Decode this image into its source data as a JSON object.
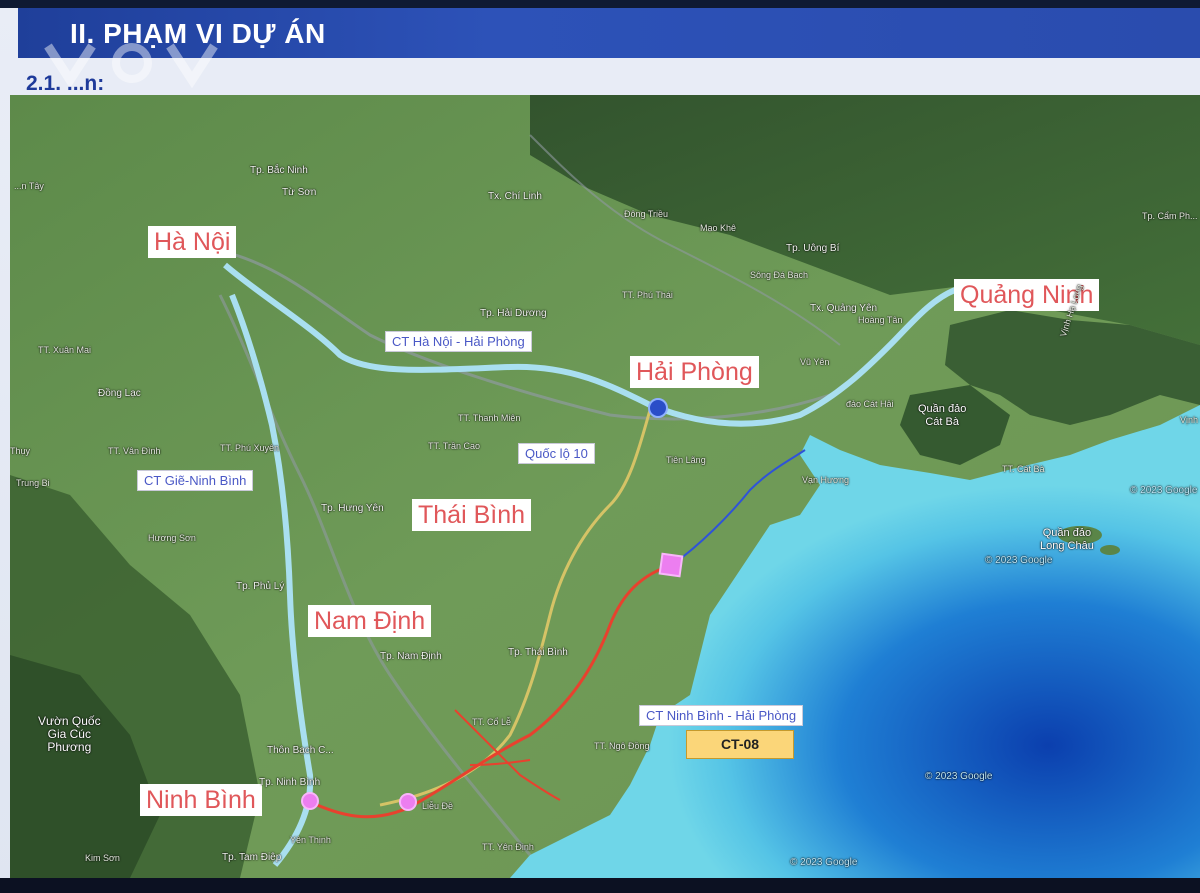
{
  "header": {
    "title": "II. PHẠM VI DỰ ÁN",
    "subheading": "2.1. ...n:"
  },
  "colors": {
    "title_bar": "#2a4cae",
    "city_label_text": "#e0575a",
    "route_label_text": "#4a58c6",
    "expressway_existing": "#a9dff0",
    "project_route": "#e8412e",
    "coastal_route": "#2f53d8",
    "badge_bg": "#fbd679"
  },
  "map": {
    "cities": [
      {
        "id": "ha-noi",
        "label": "Hà Nội"
      },
      {
        "id": "quang-ninh",
        "label": "Quảng Ninh"
      },
      {
        "id": "hai-phong",
        "label": "Hải Phòng"
      },
      {
        "id": "thai-binh",
        "label": "Thái Bình"
      },
      {
        "id": "nam-dinh",
        "label": "Nam Định"
      },
      {
        "id": "ninh-binh",
        "label": "Ninh Bình"
      }
    ],
    "routes": [
      {
        "id": "ct-hn-hp",
        "label": "CT Hà Nội - Hải Phòng"
      },
      {
        "id": "ql10",
        "label": "Quốc lộ 10"
      },
      {
        "id": "ct-gie-nb",
        "label": "CT Giẽ-Ninh Bình"
      },
      {
        "id": "ct-nb-hp",
        "label": "CT Ninh Bình - Hải Phòng"
      }
    ],
    "project_code": "CT-08",
    "places": [
      {
        "id": "bac-ninh",
        "label": "Tp. Bắc Ninh"
      },
      {
        "id": "tu-son",
        "label": "Từ Sơn"
      },
      {
        "id": "chi-linh",
        "label": "Tx. Chí Linh"
      },
      {
        "id": "hai-duong",
        "label": "Tp. Hải Dương"
      },
      {
        "id": "uong-bi",
        "label": "Tp. Uông Bí"
      },
      {
        "id": "song-da-bach",
        "label": "Sông Đá Bạch"
      },
      {
        "id": "quang-yen",
        "label": "Tx. Quảng Yên"
      },
      {
        "id": "hung-yen",
        "label": "Tp. Hưng Yên"
      },
      {
        "id": "phu-ly",
        "label": "Tp. Phủ Lý"
      },
      {
        "id": "tp-nam-dinh",
        "label": "Tp. Nam Định"
      },
      {
        "id": "tp-thai-binh",
        "label": "Tp. Thái Bình"
      },
      {
        "id": "tp-ninh-binh",
        "label": "Tp. Ninh Bình"
      },
      {
        "id": "tam-diep",
        "label": "Tp. Tam Điệp"
      },
      {
        "id": "yen-thinh",
        "label": "Yên Thịnh"
      },
      {
        "id": "kim-son",
        "label": "Kim Sơn"
      },
      {
        "id": "dong-lac",
        "label": "Đồng Lạc"
      },
      {
        "id": "tien-lang",
        "label": "Tiên Lãng"
      },
      {
        "id": "van-huong",
        "label": "Vạn Hương"
      },
      {
        "id": "thon-bach",
        "label": "Thôn Bạch C..."
      },
      {
        "id": "lieu-de",
        "label": "Liễu Đề"
      },
      {
        "id": "hoang-tan",
        "label": "Hoàng Tân"
      },
      {
        "id": "cam-pha",
        "label": "Tp. Cẩm Ph..."
      },
      {
        "id": "tt-phu-thai",
        "label": "TT. Phú Thái"
      },
      {
        "id": "tt-thanh-mien",
        "label": "TT. Thanh Miện"
      },
      {
        "id": "tt-tran-cao",
        "label": "TT. Trần Cao"
      },
      {
        "id": "tt-van-dinh",
        "label": "TT. Vân Đình"
      },
      {
        "id": "tt-phu-xuyen",
        "label": "TT. Phú Xuyên"
      },
      {
        "id": "tt-xuan-mai",
        "label": "TT. Xuân Mai"
      },
      {
        "id": "tt-yen-dinh",
        "label": "TT. Yên Định"
      },
      {
        "id": "tt-co-le",
        "label": "TT. Cổ Lễ"
      },
      {
        "id": "tt-ngo-dong",
        "label": "TT. Ngô Đồng"
      },
      {
        "id": "dong-trieu",
        "label": "Đông Triều"
      },
      {
        "id": "mao-khe",
        "label": "Mạo Khê"
      },
      {
        "id": "vu-yen",
        "label": "Vũ Yên"
      },
      {
        "id": "dao-cat-hai",
        "label": "đảo Cát Hải"
      },
      {
        "id": "tt-cat-ba",
        "label": "TT. Cát Bà"
      },
      {
        "id": "thuy",
        "label": "Thụy"
      },
      {
        "id": "trung-bi",
        "label": "Trung Bi"
      },
      {
        "id": "huong-son",
        "label": "Hương Sơn"
      },
      {
        "id": "xa-tay",
        "label": "...n Tây"
      }
    ],
    "islands": [
      {
        "id": "cat-ba",
        "label": "Quần đảo\nCát Bà"
      },
      {
        "id": "long-chau",
        "label": "Quần đảo\nLong Châu"
      },
      {
        "id": "vuon-quoc-gia",
        "label": "Vườn Quốc\nGia Cúc\nPhương"
      },
      {
        "id": "vinh-ha-long",
        "label": "Vịnh Hạ Long"
      },
      {
        "id": "vinh-lan-ha",
        "label": "Vịnh Lan Hạ"
      }
    ],
    "watermarks": [
      "© 2023 Google",
      "© 2023 Google",
      "© 2023 Google",
      "© 2023 Google"
    ]
  }
}
